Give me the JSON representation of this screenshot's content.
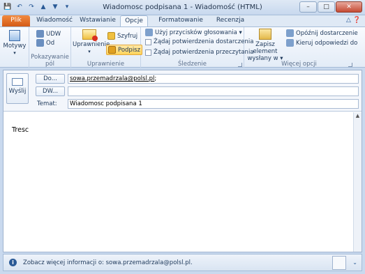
{
  "window": {
    "title": "Wiadomosc podpisana 1 - Wiadomość (HTML)",
    "minimize": "–",
    "maximize": "□",
    "close": "✕"
  },
  "qat": {
    "save": "💾",
    "undo": "↶",
    "redo": "↷",
    "up": "▲",
    "down": "▼",
    "more": "▾"
  },
  "tabs": [
    "Plik",
    "Wiadomość",
    "Wstawianie",
    "Opcje",
    "Formatowanie tekstu",
    "Recenzja"
  ],
  "tab_controls": "△ ❓",
  "ribbon": {
    "motywy": {
      "label": "Motywy"
    },
    "pokazywanie_pol": {
      "udw": "UDW",
      "od": "Od",
      "group_label": "Pokazywanie pól"
    },
    "uprawnienie": {
      "uprawnienie": "Uprawnienie",
      "szyfruj": "Szyfruj",
      "podpisz": "Podpisz",
      "group_label": "Uprawnienie"
    },
    "sledzenie": {
      "przyciski": "Użyj przycisków głosowania ▾",
      "dostarczenie": "Żądaj potwierdzenia dostarczenia",
      "przeczytanie": "Żądaj potwierdzenia przeczytania",
      "group_label": "Śledzenie"
    },
    "wiecej_opcji": {
      "zapisz": "Zapisz element",
      "wyslany_w": "wysłany w ▾",
      "opoznij": "Opóźnij dostarczenie",
      "kieruj": "Kieruj odpowiedzi do",
      "group_label": "Więcej opcji"
    }
  },
  "compose": {
    "send_label": "Wyślij",
    "do_label": "Do...",
    "dw_label": "DW...",
    "temat_label": "Temat:",
    "to_value": "sowa.przemadrzala@polsl.pl",
    "to_suffix": ";",
    "dw_value": "",
    "subject_value": "Wiadomosc podpisana 1",
    "body": "Tresc"
  },
  "infobar": {
    "text": "Zobacz więcej informacji o: sowa.przemadrzala@polsl.pl.",
    "collapse": "⌄"
  },
  "colors": {
    "file_tab": "#d35a16",
    "accent": "#2a5a96",
    "podpisz_highlight": "#ffd35a"
  }
}
